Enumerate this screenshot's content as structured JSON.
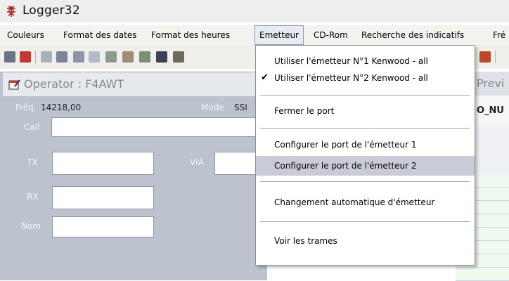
{
  "app": {
    "title": "Logger32"
  },
  "menubar": [
    "Couleurs",
    "Format des dates",
    "Format des heures",
    "Emetteur",
    "CD-Rom",
    "Recherche des indicatifs",
    "Fré"
  ],
  "operator": {
    "title": "Operator : F4AWT",
    "freq_label": "Fréq.",
    "freq_value": "14218,00",
    "mode_label": "Mode",
    "mode_value": "SSI",
    "call_label": "Call",
    "tx_label": "TX",
    "via_label": "VIA",
    "rx_label": "RX",
    "nom_label": "Nom"
  },
  "right": {
    "preview_label": "Previ",
    "grid_header": "O_NU"
  },
  "dropdown": {
    "items": [
      {
        "label": "Utiliser l'émetteur N°1  Kenwood - all",
        "checked": false
      },
      {
        "label": "Utiliser l'émetteur N°2  Kenwood - all",
        "checked": true
      },
      {
        "label": "Fermer le port",
        "checked": false
      },
      {
        "label": "Configurer le port de l'émetteur 1",
        "checked": false
      },
      {
        "label": "Configurer le port de l'émetteur 2",
        "checked": false,
        "highlighted": true
      },
      {
        "label": "Changement automatique d'émetteur",
        "checked": false
      },
      {
        "label": "Voir les trames",
        "checked": false
      }
    ],
    "check_glyph": "✔"
  },
  "colors": {
    "accent_highlight": "#c9cbd7",
    "panel_bg": "#bcc3cf",
    "grid_row_bg": "#eefaf0"
  }
}
